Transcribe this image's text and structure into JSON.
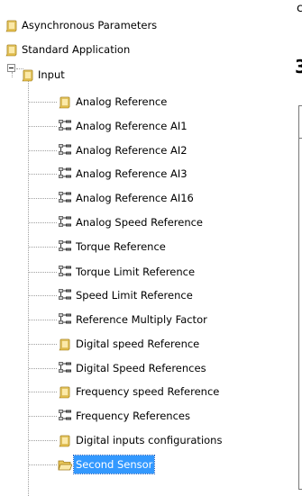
{
  "tree": {
    "items": [
      {
        "label": "Asynchronous Parameters",
        "icon": "folder-icon"
      },
      {
        "label": "Standard Application",
        "icon": "folder-icon"
      },
      {
        "label": "Input",
        "icon": "folder-icon",
        "expanded": true
      },
      {
        "label": "Analog Reference",
        "icon": "folder-icon"
      },
      {
        "label": "Analog Reference AI1",
        "icon": "parameter-group-icon"
      },
      {
        "label": "Analog Reference AI2",
        "icon": "parameter-group-icon"
      },
      {
        "label": "Analog Reference AI3",
        "icon": "parameter-group-icon"
      },
      {
        "label": "Analog Reference AI16",
        "icon": "parameter-group-icon"
      },
      {
        "label": "Analog Speed Reference",
        "icon": "parameter-group-icon"
      },
      {
        "label": "Torque Reference",
        "icon": "parameter-group-icon"
      },
      {
        "label": "Torque Limit Reference",
        "icon": "parameter-group-icon"
      },
      {
        "label": "Speed Limit Reference",
        "icon": "parameter-group-icon"
      },
      {
        "label": "Reference Multiply Factor",
        "icon": "parameter-group-icon"
      },
      {
        "label": "Digital speed Reference",
        "icon": "folder-icon"
      },
      {
        "label": "Digital Speed References",
        "icon": "parameter-group-icon"
      },
      {
        "label": "Frequency speed Reference",
        "icon": "folder-icon"
      },
      {
        "label": "Frequency References",
        "icon": "parameter-group-icon"
      },
      {
        "label": "Digital inputs configurations",
        "icon": "folder-icon"
      },
      {
        "label": "Second Sensor",
        "icon": "open-folder-icon",
        "selected": true
      }
    ]
  },
  "right_panel": {
    "partial_text_1": "c",
    "partial_text_2": "3"
  },
  "colors": {
    "selection": "#3399ff",
    "folder": "#f1d36a",
    "tree_lines": "#a0a0a0"
  }
}
